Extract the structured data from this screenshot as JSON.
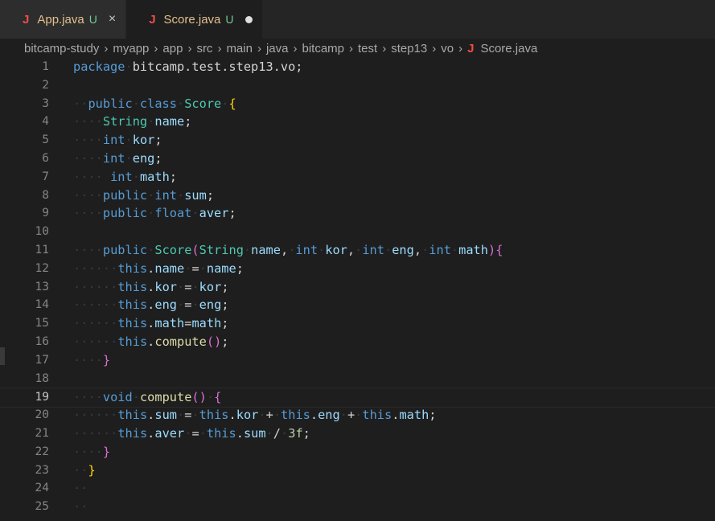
{
  "tabs": [
    {
      "icon": "J",
      "name": "App.java",
      "status": "U",
      "close": "×"
    },
    {
      "icon": "J",
      "name": "Score.java",
      "status": "U"
    }
  ],
  "breadcrumb": {
    "parts": [
      "bitcamp-study",
      "myapp",
      "app",
      "src",
      "main",
      "java",
      "bitcamp",
      "test",
      "step13",
      "vo"
    ],
    "file_icon": "J",
    "file": "Score.java"
  },
  "editor": {
    "current_line": 19,
    "lines": [
      {
        "n": "1",
        "text": "package bitcamp.test.step13.vo;"
      },
      {
        "n": "2",
        "text": ""
      },
      {
        "n": "3",
        "text": "public class Score {"
      },
      {
        "n": "4",
        "text": "String name;"
      },
      {
        "n": "5",
        "text": "int kor;"
      },
      {
        "n": "6",
        "text": "int eng;"
      },
      {
        "n": "7",
        "text": "int math;"
      },
      {
        "n": "8",
        "text": "public int sum;"
      },
      {
        "n": "9",
        "text": "public float aver;"
      },
      {
        "n": "10",
        "text": ""
      },
      {
        "n": "11",
        "text": "public Score(String name, int kor, int eng, int math){"
      },
      {
        "n": "12",
        "text": "this.name = name;"
      },
      {
        "n": "13",
        "text": "this.kor = kor;"
      },
      {
        "n": "14",
        "text": "this.eng = eng;"
      },
      {
        "n": "15",
        "text": "this.math=math;"
      },
      {
        "n": "16",
        "text": "this.compute();"
      },
      {
        "n": "17",
        "text": "}"
      },
      {
        "n": "18",
        "text": ""
      },
      {
        "n": "19",
        "text": "void compute() {"
      },
      {
        "n": "20",
        "text": "this.sum = this.kor + this.eng + this.math;"
      },
      {
        "n": "21",
        "text": "this.aver = this.sum / 3f;"
      },
      {
        "n": "22",
        "text": "}"
      },
      {
        "n": "23",
        "text": "}"
      },
      {
        "n": "24",
        "text": ""
      },
      {
        "n": "25",
        "text": ""
      }
    ]
  },
  "colors": {
    "background": "#1e1e1e",
    "keyword": "#569cd6",
    "type": "#4ec9b0",
    "identifier": "#9cdcfe",
    "function": "#dcdcaa",
    "number": "#b5cea8",
    "java_icon": "#f14c4c",
    "untracked_badge": "#73c991",
    "modified_file": "#e2c08d"
  }
}
